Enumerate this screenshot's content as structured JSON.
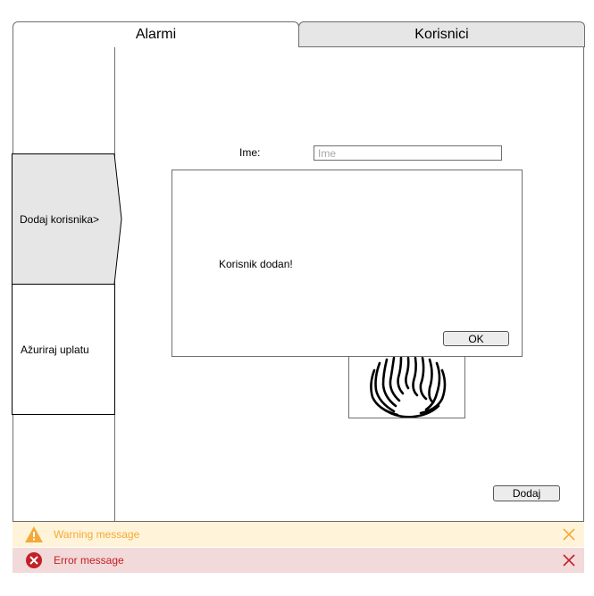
{
  "tabs": [
    {
      "label": "Alarmi"
    },
    {
      "label": "Korisnici"
    }
  ],
  "sidebar": {
    "items": [
      {
        "label": "Dodaj korisnika>"
      },
      {
        "label": "Ažuriraj uplatu"
      }
    ]
  },
  "form": {
    "ime_label": "Ime:",
    "ime_placeholder": "Ime",
    "add_button_label": "Dodaj"
  },
  "dialog": {
    "message": "Korisnik dodan!",
    "ok_label": "OK"
  },
  "messages": {
    "warning": "Warning message",
    "error": "Error message"
  },
  "colors": {
    "warning_text": "#f4a93a",
    "warning_bg": "#fff4d9",
    "error_text": "#c22127",
    "error_bg": "#f2d9da",
    "selected_bg": "#e6e6e6"
  },
  "icons": {
    "warning": "warning-triangle-icon",
    "error": "error-circle-icon",
    "close": "close-x-icon",
    "fingerprint": "fingerprint-icon"
  }
}
